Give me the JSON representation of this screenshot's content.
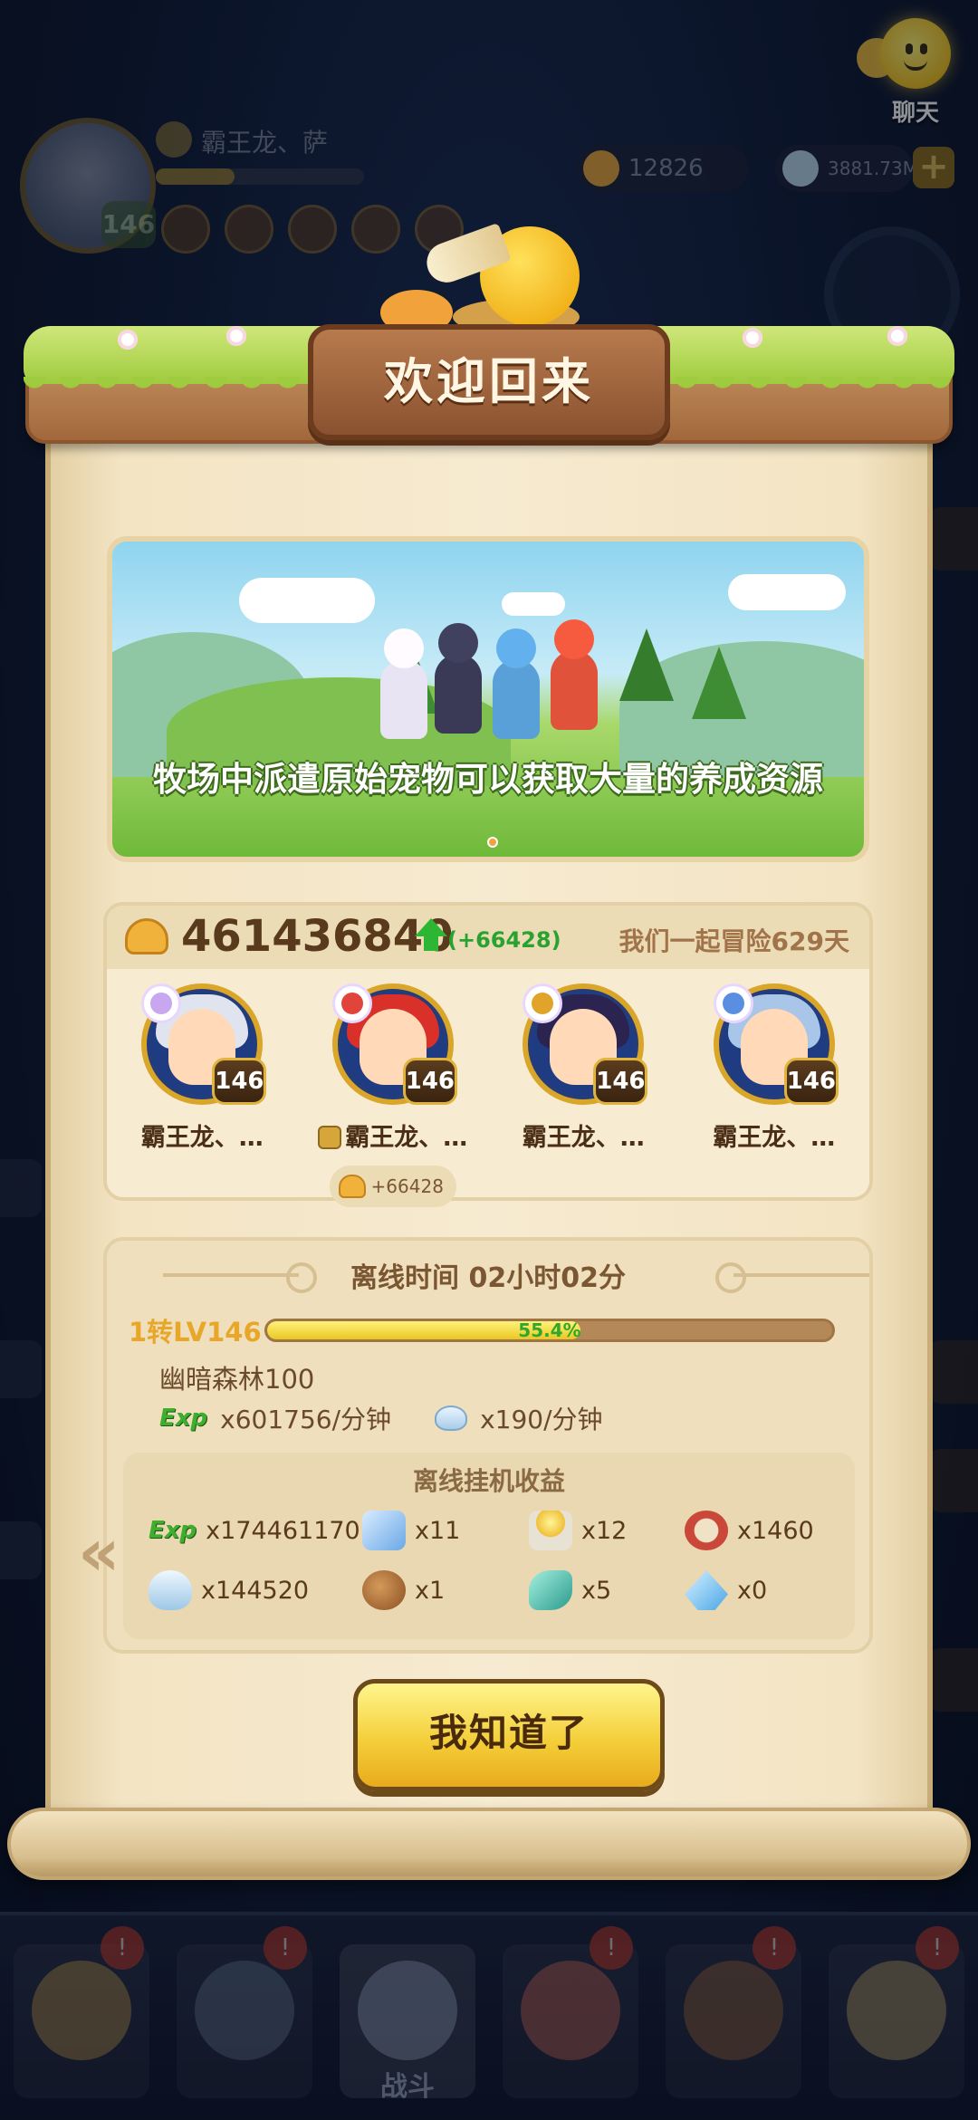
{
  "hud": {
    "player_name": "霸王龙、萨",
    "player_level": "146",
    "currency_1": "12826",
    "currency_2": "3881.73M",
    "plus": "+",
    "chat_label": "聊天"
  },
  "dialog": {
    "title": "欢迎回来",
    "banner_text": "牧场中派遣原始宠物可以获取大量的养成资源",
    "power_value": "461436840",
    "power_gain": "(+66428)",
    "adventure_days": "我们一起冒险629天",
    "heroes": [
      {
        "level": "146",
        "name": "霸王龙、…",
        "element_icon": "ghost-icon",
        "hair_color": "#dfe4ee"
      },
      {
        "level": "146",
        "name": "霸王龙、…",
        "element_icon": "fire-icon",
        "hair_color": "#d9302a",
        "is_leader": true,
        "gain": "+66428"
      },
      {
        "level": "146",
        "name": "霸王龙、…",
        "element_icon": "trident-icon",
        "hair_color": "#2b2450"
      },
      {
        "level": "146",
        "name": "霸王龙、…",
        "element_icon": "sword-icon",
        "hair_color": "#a9c6e8"
      }
    ],
    "offline_time": "离线时间 02小时02分",
    "level_label": "1转LV146",
    "exp_percent_label": "55.4%",
    "exp_fraction": 0.554,
    "stage": "幽暗森林100",
    "exp_tag": "Exp",
    "exp_rate": "x601756/分钟",
    "shell_rate": "x190/分钟",
    "rewards_title": "离线挂机收益",
    "rewards": [
      {
        "icon": "exp-icon",
        "amount": "x174461170"
      },
      {
        "icon": "scroll-icon",
        "amount": "x11"
      },
      {
        "icon": "candle-icon",
        "amount": "x12"
      },
      {
        "icon": "medal-icon",
        "amount": "x1460"
      },
      {
        "icon": "shell-icon",
        "amount": "x144520"
      },
      {
        "icon": "meat-icon",
        "amount": "x1"
      },
      {
        "icon": "feather-gem-icon",
        "amount": "x5"
      },
      {
        "icon": "crystal-icon",
        "amount": "x0"
      }
    ],
    "prev_arrow": "«",
    "confirm_label": "我知道了"
  },
  "bottom_nav": {
    "battle_label": "战斗"
  },
  "colors": {
    "gold_border": "#d9a62a",
    "wood": "#8a5230",
    "grass": "#9fcb3e",
    "exp_green": "#3fae2e",
    "button_yellow": "#f4cf3a"
  }
}
